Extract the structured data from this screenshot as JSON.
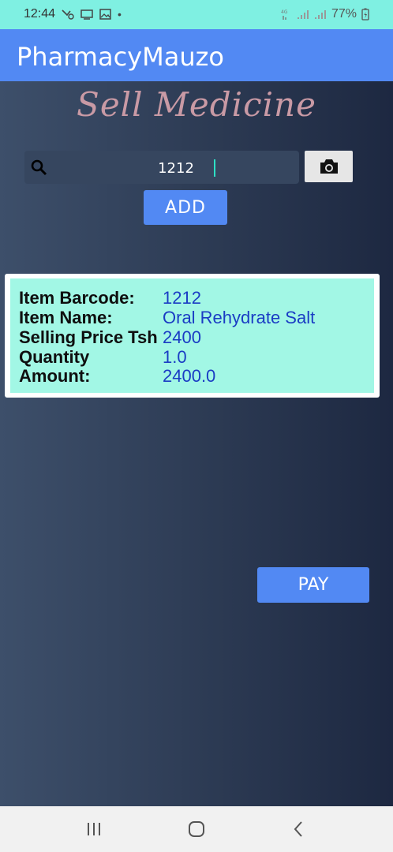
{
  "status_bar": {
    "time": "12:44",
    "battery": "77%",
    "dot": "•"
  },
  "app": {
    "title": "PharmacyMauzo"
  },
  "screen": {
    "heading": "Sell Medicine"
  },
  "search": {
    "value": "1212",
    "placeholder": ""
  },
  "buttons": {
    "add": "ADD",
    "pay": "PAY"
  },
  "item": {
    "rows": [
      {
        "label": "Item Barcode:",
        "value": "1212"
      },
      {
        "label": "Item Name:",
        "value": "Oral Rehydrate Salt"
      },
      {
        "label": "Selling Price Tsh",
        "value": "2400"
      },
      {
        "label": "Quantity",
        "value": "1.0"
      },
      {
        "label": "Amount:",
        "value": "2400.0"
      }
    ]
  },
  "colors": {
    "status_bar": "#7ff0e2",
    "app_bar": "#5289f3",
    "card_fill": "#a2f7e5",
    "value_text": "#1a3cc4",
    "heading": "#c99aa5"
  },
  "icons": {
    "search": "search-icon",
    "camera": "camera-icon",
    "recents": "recents-icon",
    "home": "home-icon",
    "back": "back-icon"
  }
}
